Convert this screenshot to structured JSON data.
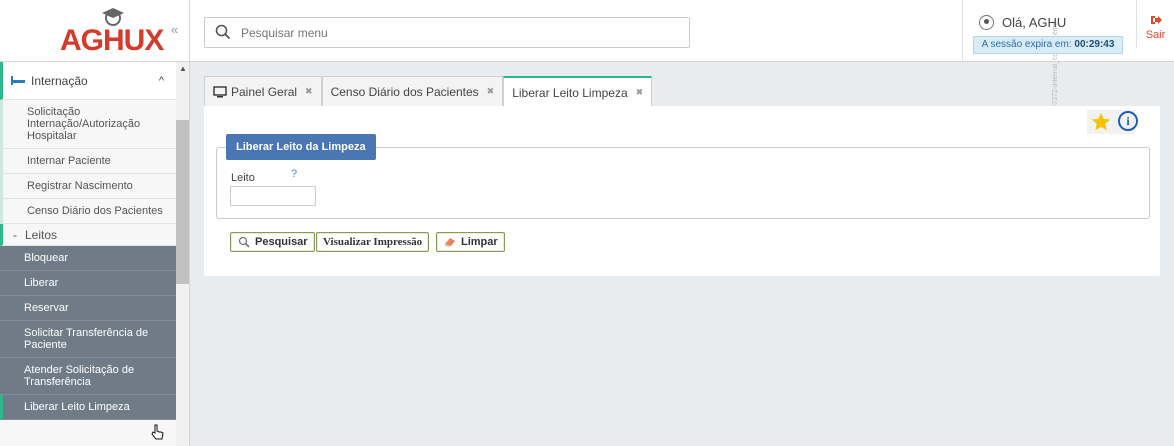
{
  "app": {
    "logo_text": "AGHUX",
    "version_text": "V 10.65.11.47372-internal_conver_emir"
  },
  "colors": {
    "accent": "#2eb88a",
    "logo_red": "#d63a2a",
    "legend_blue": "#4a77b4",
    "sidebar_dark": "#6f7c88"
  },
  "header": {
    "search_placeholder": "Pesquisar menu",
    "greeting": "Olá, AGHU",
    "session_label": "A sessão expira em:",
    "session_time": "00:29:43",
    "logout_label": "Sair"
  },
  "sidebar": {
    "category": "Internação",
    "items": [
      "Solicitação Internação/Autorização Hospitalar",
      "Internar Paciente",
      "Registrar Nascimento",
      "Censo Diário dos Pacientes"
    ],
    "subgroup": "Leitos",
    "subitems": [
      "Bloquear",
      "Liberar",
      "Reservar",
      "Solicitar Transferência de Paciente",
      "Atender Solicitação de Transferência",
      "Liberar Leito Limpeza"
    ]
  },
  "tabs": [
    {
      "label": "Painel Geral"
    },
    {
      "label": "Censo Diário dos Pacientes"
    },
    {
      "label": "Liberar Leito Limpeza"
    }
  ],
  "form": {
    "legend": "Liberar Leito da Limpeza",
    "leito_label": "Leito",
    "help": "?",
    "leito_value": ""
  },
  "buttons": {
    "search": "Pesquisar",
    "print": "Visualizar Impressão",
    "clear": "Limpar"
  }
}
